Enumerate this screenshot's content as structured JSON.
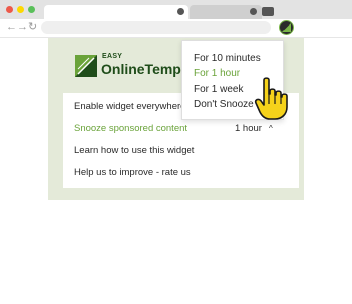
{
  "colors": {
    "accent": "#6aa33a",
    "popup_bg": "#e4ead9",
    "brand_dark": "#1f4d1a",
    "cursor": "#f5d21b"
  },
  "browser": {
    "nav_icons": [
      "back-arrow-icon",
      "forward-arrow-icon",
      "reload-icon"
    ],
    "back_glyph": "←",
    "forward_glyph": "→",
    "reload_glyph": "↻",
    "extension_icon": "online-temp-extension-icon"
  },
  "popup": {
    "logo": {
      "easy": "EASY",
      "name": "OnlineTemp"
    },
    "menu_items": [
      "Enable widget everywhere",
      "Snooze sponsored content",
      "Learn how to use this widget",
      "Help us to improve - rate us"
    ],
    "snooze_value": "1 hour",
    "chevron_up": "^"
  },
  "dropdown": {
    "options": [
      "For 10 minutes",
      "For 1 hour",
      "For 1 week",
      "Don't Snooze"
    ],
    "selected": "For 1 hour"
  }
}
